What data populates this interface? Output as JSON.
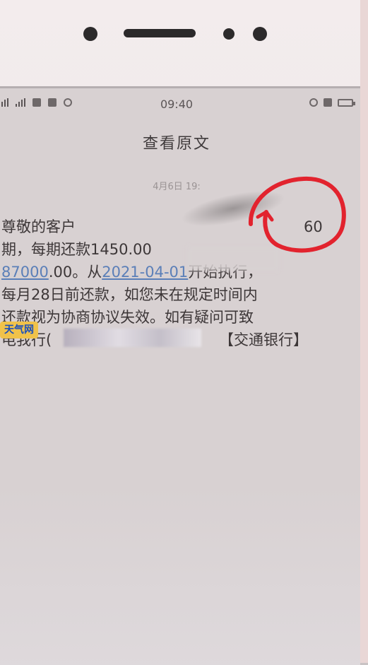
{
  "status_bar": {
    "time": "09:40"
  },
  "nav": {
    "title": "查看原文"
  },
  "message": {
    "date": "4月6日 19:",
    "lines": [
      {
        "text": "尊敬的客户",
        "suffix": "60"
      },
      {
        "text": "期，每期还款1450.00"
      },
      {
        "link1": "87000",
        "text1": ".00。从",
        "link2": "2021-04-01",
        "text2": "开始执行，"
      },
      {
        "text": "每月28日前还款，如您未在规定时间内"
      },
      {
        "text": "还款视为协商协议失效。如有疑问可致"
      },
      {
        "prefix": "电我行(",
        "suffix": "【交通银行】"
      }
    ]
  },
  "watermark": {
    "text": "天气网"
  },
  "colors": {
    "link": "#5b7fb8",
    "annotation": "#e2232e",
    "watermark_bg": "#f0c24a",
    "watermark_text": "#1a4fbd"
  }
}
